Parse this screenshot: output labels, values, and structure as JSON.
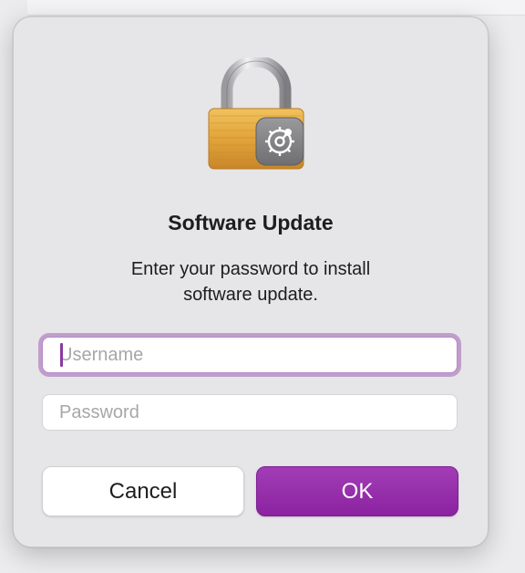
{
  "dialog": {
    "title": "Software Update",
    "message": "Enter your password to install software update.",
    "icon": "lock-with-gear-icon",
    "accent_color": "#9b31b0"
  },
  "fields": {
    "username": {
      "placeholder": "Username",
      "value": ""
    },
    "password": {
      "placeholder": "Password",
      "value": ""
    }
  },
  "buttons": {
    "cancel_label": "Cancel",
    "ok_label": "OK"
  }
}
